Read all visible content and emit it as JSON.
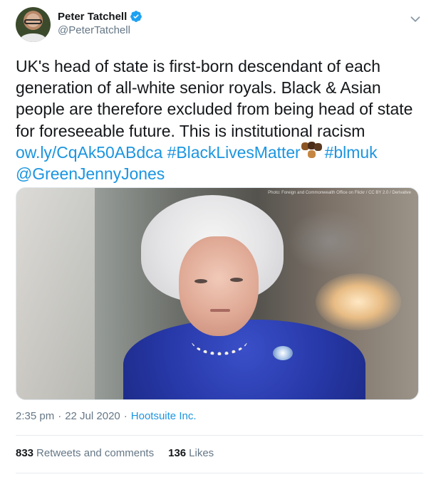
{
  "author": {
    "display_name": "Peter Tatchell",
    "handle": "@PeterTatchell",
    "verified": true,
    "avatar_icon": "avatar-photo"
  },
  "menu_icon": "chevron-down-icon",
  "tweet": {
    "text_plain": "UK's head of state is first-born descendant of each generation of all-white senior royals. Black & Asian people are therefore excluded from being head of state for foreseeable future. This is institutional racism",
    "link": "ow.ly/CqAk50ABdca",
    "hashtag1": "#BlackLivesMatter",
    "emoji": "raised-fists-emoji",
    "hashtag2": "#blmuk",
    "mention": "@GreenJennyJones"
  },
  "media": {
    "credit": "Photo: Foreign and Commonwealth Office on Flickr / CC BY 2.0 / Derivative"
  },
  "meta": {
    "time": "2:35 pm",
    "separator": "·",
    "date": "22 Jul 2020",
    "source": "Hootsuite Inc."
  },
  "stats": {
    "retweets_count": "833",
    "retweets_label": "Retweets and comments",
    "likes_count": "136",
    "likes_label": "Likes"
  },
  "colors": {
    "link": "#1b95e0",
    "secondary_text": "#657786",
    "primary_text": "#14171a",
    "divider": "#e6ecf0"
  }
}
